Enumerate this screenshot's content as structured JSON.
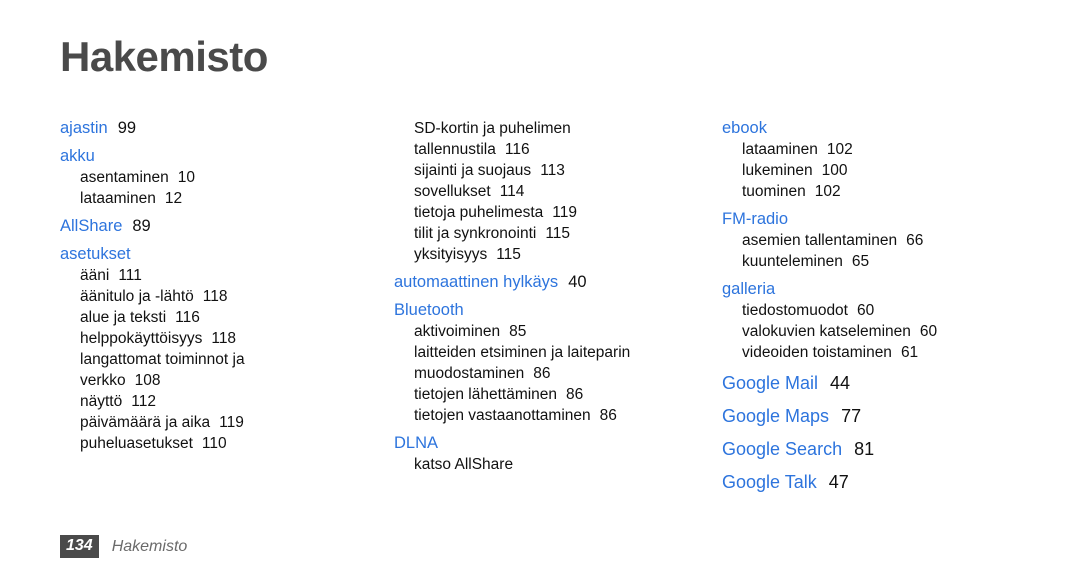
{
  "page": {
    "title": "Hakemisto",
    "accent_color": "#2d74dd",
    "title_color": "#4a4a4a",
    "body_color": "#111111",
    "background_color": "#ffffff"
  },
  "footer": {
    "page_number": "134",
    "label": "Hakemisto",
    "badge_background": "#4a4a4a",
    "badge_text_color": "#ffffff"
  },
  "columns": [
    {
      "id": "column-1",
      "groups": [
        {
          "head": {
            "text": "ajastin",
            "page": "99"
          },
          "subs": []
        },
        {
          "head": {
            "text": "akku",
            "page": ""
          },
          "subs": [
            {
              "text": "asentaminen",
              "page": "10"
            },
            {
              "text": "lataaminen",
              "page": "12"
            }
          ]
        },
        {
          "head": {
            "text": "AllShare",
            "page": "89"
          },
          "subs": []
        },
        {
          "head": {
            "text": "asetukset",
            "page": ""
          },
          "subs": [
            {
              "text": "ääni",
              "page": "111"
            },
            {
              "text": "äänitulo ja -lähtö",
              "page": "118"
            },
            {
              "text": "alue ja teksti",
              "page": "116"
            },
            {
              "text": "helppokäyttöisyys",
              "page": "118"
            },
            {
              "text": "langattomat toiminnot ja",
              "page": ""
            },
            {
              "text": "verkko",
              "page": "108"
            },
            {
              "text": "näyttö",
              "page": "112"
            },
            {
              "text": "päivämäärä ja aika",
              "page": "119"
            },
            {
              "text": "puheluasetukset",
              "page": "110"
            }
          ]
        }
      ]
    },
    {
      "id": "column-2",
      "groups": [
        {
          "head": null,
          "subs": [
            {
              "text": "SD-kortin ja puhelimen",
              "page": ""
            },
            {
              "text": "tallennustila",
              "page": "116"
            },
            {
              "text": "sijainti ja suojaus",
              "page": "113"
            },
            {
              "text": "sovellukset",
              "page": "114"
            },
            {
              "text": "tietoja puhelimesta",
              "page": "119"
            },
            {
              "text": "tilit ja synkronointi",
              "page": "115"
            },
            {
              "text": "yksityisyys",
              "page": "115"
            }
          ]
        },
        {
          "head": {
            "text": "automaattinen hylkäys",
            "page": "40"
          },
          "subs": []
        },
        {
          "head": {
            "text": "Bluetooth",
            "page": ""
          },
          "subs": [
            {
              "text": "aktivoiminen",
              "page": "85"
            },
            {
              "text": "laitteiden etsiminen ja laiteparin",
              "page": ""
            },
            {
              "text": "muodostaminen",
              "page": "86"
            },
            {
              "text": "tietojen lähettäminen",
              "page": "86"
            },
            {
              "text": "tietojen vastaanottaminen",
              "page": "86"
            }
          ]
        },
        {
          "head": {
            "text": "DLNA",
            "page": ""
          },
          "subs": [
            {
              "text": "katso AllShare",
              "page": ""
            }
          ]
        }
      ]
    },
    {
      "id": "column-3",
      "groups": [
        {
          "head": {
            "text": "ebook",
            "page": ""
          },
          "subs": [
            {
              "text": "lataaminen",
              "page": "102"
            },
            {
              "text": "lukeminen",
              "page": "100"
            },
            {
              "text": "tuominen",
              "page": "102"
            }
          ]
        },
        {
          "head": {
            "text": "FM-radio",
            "page": ""
          },
          "subs": [
            {
              "text": "asemien tallentaminen",
              "page": "66"
            },
            {
              "text": "kuunteleminen",
              "page": "65"
            }
          ]
        },
        {
          "head": {
            "text": "galleria",
            "page": ""
          },
          "subs": [
            {
              "text": "tiedostomuodot",
              "page": "60"
            },
            {
              "text": "valokuvien katseleminen",
              "page": "60"
            },
            {
              "text": "videoiden toistaminen",
              "page": "61"
            }
          ]
        },
        {
          "head": {
            "text": "Google Mail",
            "page": "44",
            "large": true
          },
          "subs": []
        },
        {
          "head": {
            "text": "Google Maps",
            "page": "77",
            "large": true
          },
          "subs": []
        },
        {
          "head": {
            "text": "Google Search",
            "page": "81",
            "large": true
          },
          "subs": []
        },
        {
          "head": {
            "text": "Google Talk",
            "page": "47",
            "large": true
          },
          "subs": []
        }
      ]
    }
  ]
}
